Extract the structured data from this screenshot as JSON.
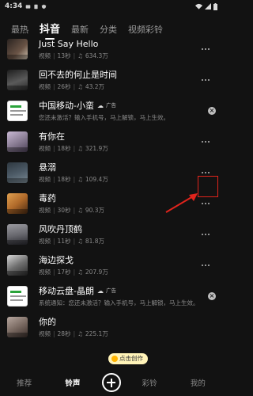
{
  "status": {
    "time": "4:34"
  },
  "tabs": [
    {
      "label": "最热",
      "active": false
    },
    {
      "label": "抖音",
      "active": true
    },
    {
      "label": "最新",
      "active": false
    },
    {
      "label": "分类",
      "active": false
    },
    {
      "label": "视频彩铃",
      "active": false
    }
  ],
  "rows": [
    {
      "type": "track",
      "title": "Just Say Hello",
      "kind": "视频",
      "duration": "13秒",
      "plays": "634.3万",
      "thumb_color": "#5a4a3e"
    },
    {
      "type": "track",
      "title": "回不去的何止是时间",
      "kind": "视频",
      "duration": "26秒",
      "plays": "43.2万",
      "thumb_color": "#3d3d3d"
    },
    {
      "type": "ad",
      "title": "中国移动-小蛮",
      "ad_label": "广告",
      "desc": "您还未激活？输入手机号，马上解锁，马上生效。"
    },
    {
      "type": "track",
      "title": "有你在",
      "kind": "视频",
      "duration": "18秒",
      "plays": "321.9万",
      "thumb_color": "#8c7f96"
    },
    {
      "type": "track",
      "title": "悬溺",
      "kind": "视频",
      "duration": "18秒",
      "plays": "109.4万",
      "thumb_color": "#4c5a66"
    },
    {
      "type": "track",
      "title": "毒药",
      "kind": "视频",
      "duration": "30秒",
      "plays": "90.3万",
      "thumb_color": "#b06a2a"
    },
    {
      "type": "track",
      "title": "风吹丹顶鹤",
      "kind": "视频",
      "duration": "11秒",
      "plays": "81.8万",
      "thumb_color": "#6a6a70"
    },
    {
      "type": "track",
      "title": "海边探戈",
      "kind": "视频",
      "duration": "17秒",
      "plays": "207.9万",
      "thumb_color": "#707070"
    },
    {
      "type": "ad",
      "title": "移动云盘-晶朗",
      "ad_label": "广告",
      "desc": "系统通知：您还未激活？输入手机号，马上解锁，马上生效。"
    },
    {
      "type": "track",
      "title": "你的",
      "kind": "视频",
      "duration": "28秒",
      "plays": "225.1万",
      "thumb_color": "#7a6a62"
    }
  ],
  "create_bubble": {
    "label": "点击创作"
  },
  "bottom_nav": [
    {
      "label": "推荐",
      "active": false
    },
    {
      "label": "铃声",
      "active": true
    },
    {
      "label": "彩铃",
      "active": false
    },
    {
      "label": "我的",
      "active": false
    }
  ],
  "colors": {
    "background": "#121212",
    "highlight": "#e0241c",
    "ad_green": "#2aa33a"
  }
}
